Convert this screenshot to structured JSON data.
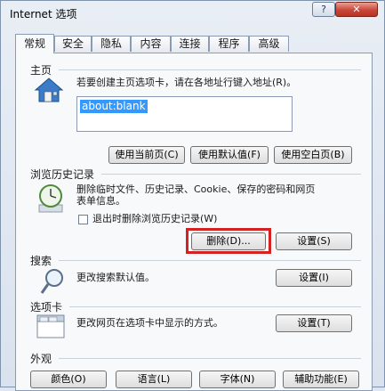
{
  "window": {
    "title": "Internet 选项",
    "help_label": "?",
    "close_label": "✕"
  },
  "tabs": [
    {
      "label": "常规"
    },
    {
      "label": "安全"
    },
    {
      "label": "隐私"
    },
    {
      "label": "内容"
    },
    {
      "label": "连接"
    },
    {
      "label": "程序"
    },
    {
      "label": "高级"
    }
  ],
  "homepage": {
    "section": "主页",
    "desc": "若要创建主页选项卡，请在各地址行键入地址(R)。",
    "url_value": "about:blank",
    "btn_current": "使用当前页(C)",
    "btn_default": "使用默认值(F)",
    "btn_blank": "使用空白页(B)",
    "icon": "house-icon"
  },
  "history": {
    "section": "浏览历史记录",
    "desc_line1": "删除临时文件、历史记录、Cookie、保存的密码和网页",
    "desc_line2": "表单信息。",
    "checkbox_label": "退出时删除浏览历史记录(W)",
    "btn_delete": "删除(D)...",
    "btn_settings": "设置(S)",
    "icon": "clock-icon"
  },
  "search": {
    "section": "搜索",
    "desc": "更改搜索默认值。",
    "btn_settings": "设置(I)",
    "icon": "magnifier-icon"
  },
  "tabs_section": {
    "section": "选项卡",
    "desc": "更改网页在选项卡中显示的方式。",
    "btn_settings": "设置(T)",
    "icon": "tab-window-icon"
  },
  "appearance": {
    "section": "外观",
    "btn_colors": "颜色(O)",
    "btn_languages": "语言(L)",
    "btn_fonts": "字体(N)",
    "btn_accessibility": "辅助功能(E)"
  },
  "colors": {
    "highlight": "#d42121",
    "selection": "#3399ff"
  }
}
